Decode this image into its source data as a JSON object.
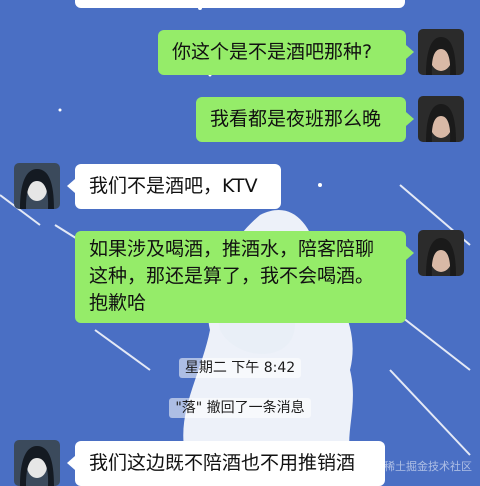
{
  "chat": {
    "messages": [
      {
        "side": "right",
        "text": "你这个是不是酒吧那种?"
      },
      {
        "side": "right",
        "text": "我看都是夜班那么晚"
      },
      {
        "side": "left",
        "text": "我们不是酒吧，KTV"
      },
      {
        "side": "right",
        "lines": [
          "如果涉及喝酒，推酒水，陪客陪聊",
          "这种，那还是算了，我不会喝酒。",
          "抱歉哈"
        ]
      },
      {
        "side": "left",
        "text": "我们这边既不陪酒也不用推销酒"
      }
    ],
    "timestamp": "星期二 下午 8:42",
    "recall_notice": "\"落\" 撤回了一条消息",
    "watermark": "@稀土掘金技术社区"
  },
  "colors": {
    "background": "#4a6fc4",
    "my_bubble": "#95ec69",
    "other_bubble": "#ffffff"
  }
}
